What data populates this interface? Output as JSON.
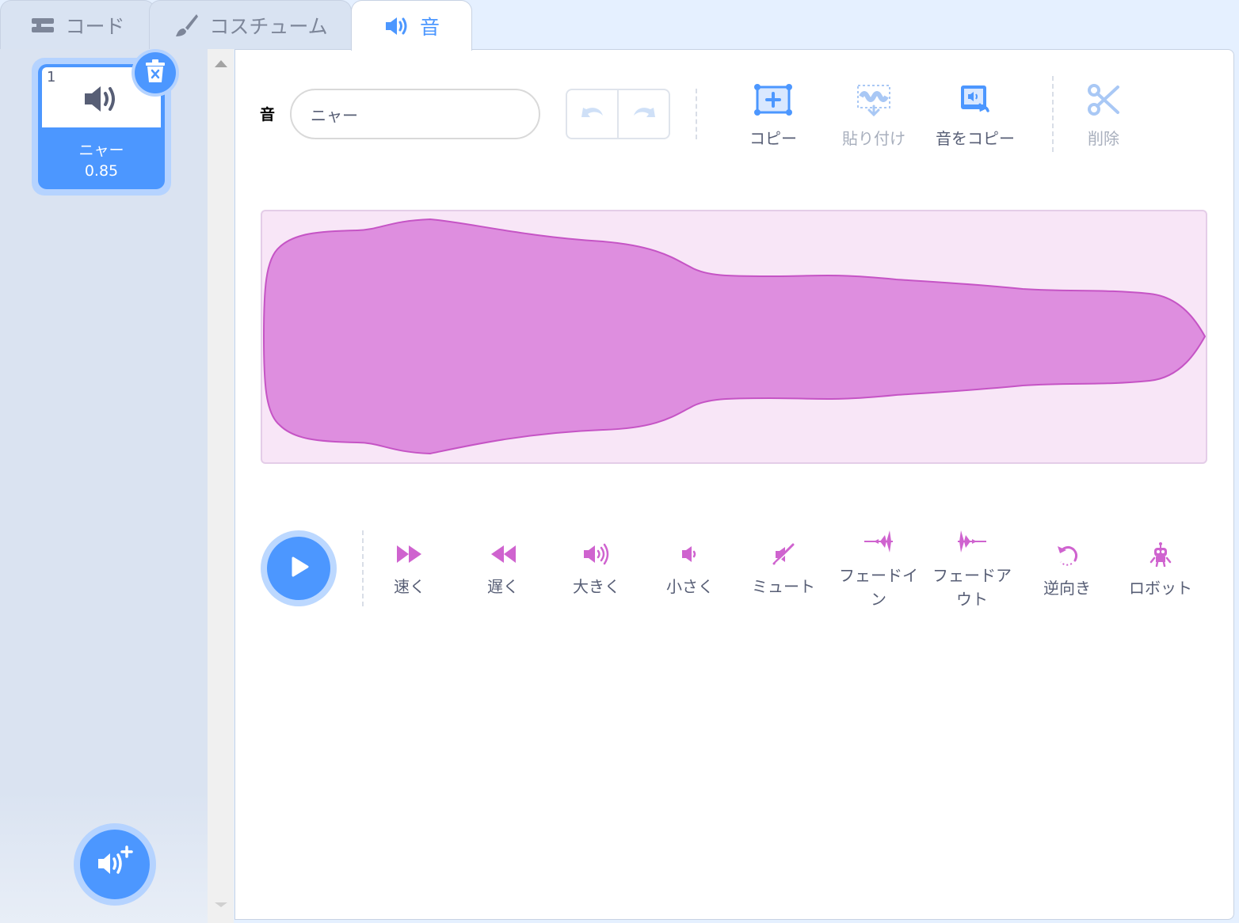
{
  "tabs": {
    "code": "コード",
    "costumes": "コスチューム",
    "sounds": "音"
  },
  "sound_list": {
    "items": [
      {
        "number": "1",
        "name": "ニャー",
        "duration": "0.85"
      }
    ]
  },
  "editor": {
    "name_label": "音",
    "name_value": "ニャー",
    "tools": {
      "copy": "コピー",
      "paste": "貼り付け",
      "copy_to_new": "音をコピー",
      "delete": "削除"
    },
    "effects": {
      "faster": "速く",
      "slower": "遅く",
      "louder": "大きく",
      "softer": "小さく",
      "mute": "ミュート",
      "fade_in": "フェードイン",
      "fade_out": "フェードアウト",
      "reverse": "逆向き",
      "robot": "ロボット"
    }
  },
  "colors": {
    "accent": "#4c97ff",
    "effect": "#cf63cf",
    "waveform_fill": "#de8edf",
    "waveform_bg": "#f8e6f7"
  },
  "icons": [
    "code-icon",
    "brush-icon",
    "speaker-icon",
    "trash-icon",
    "add-sound-icon",
    "undo-icon",
    "redo-icon",
    "copy-icon",
    "paste-icon",
    "copy-sound-icon",
    "scissors-icon",
    "play-icon",
    "faster-icon",
    "slower-icon",
    "louder-icon",
    "softer-icon",
    "mute-icon",
    "fade-in-icon",
    "fade-out-icon",
    "reverse-icon",
    "robot-icon"
  ]
}
